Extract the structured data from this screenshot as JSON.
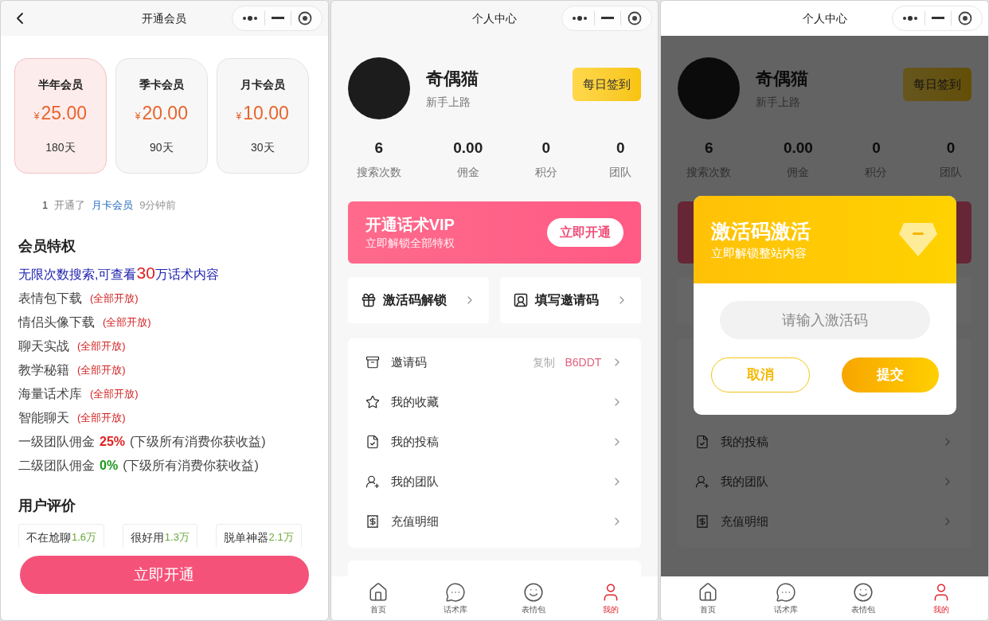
{
  "membership_page": {
    "title": "开通会员",
    "plans": [
      {
        "name": "半年会员",
        "currency": "¥",
        "price": "25.00",
        "duration": "180天",
        "selected": true
      },
      {
        "name": "季卡会员",
        "currency": "¥",
        "price": "20.00",
        "duration": "90天",
        "selected": false
      },
      {
        "name": "月卡会员",
        "currency": "¥",
        "price": "10.00",
        "duration": "30天",
        "selected": false
      }
    ],
    "ticker": {
      "index": "1",
      "action": "开通了",
      "plan": "月卡会员",
      "time": "9分钟前"
    },
    "privileges": {
      "heading": "会员特权",
      "headline": {
        "before": "无限次数搜索,可查看",
        "number": "30",
        "after": "万话术内容"
      },
      "features": [
        {
          "name": "表情包下载",
          "tag": "(全部开放)"
        },
        {
          "name": "情侣头像下载",
          "tag": "(全部开放)"
        },
        {
          "name": "聊天实战",
          "tag": "(全部开放)"
        },
        {
          "name": "教学秘籍",
          "tag": "(全部开放)"
        },
        {
          "name": "海量话术库",
          "tag": "(全部开放)"
        },
        {
          "name": "智能聊天",
          "tag": "(全部开放)"
        }
      ],
      "commissions": [
        {
          "label": "一级团队佣金",
          "rate": "25%",
          "note": "(下级所有消费你获收益)",
          "color": "#e02020"
        },
        {
          "label": "二级团队佣金",
          "rate": "0%",
          "note": "(下级所有消费你获收益)",
          "color": "#1a9a1a"
        }
      ]
    },
    "reviews": {
      "heading": "用户评价",
      "items": [
        {
          "text": "不在尬聊",
          "count": "1.6万"
        },
        {
          "text": "很好用",
          "count": "1.3万"
        },
        {
          "text": "脱单神器",
          "count": "2.1万"
        }
      ]
    },
    "cta": "立即开通"
  },
  "profile_page": {
    "title": "个人中心",
    "user": {
      "name": "奇偶猫",
      "level": "新手上路"
    },
    "checkin": "每日签到",
    "stats": [
      {
        "value": "6",
        "label": "搜索次数"
      },
      {
        "value": "0.00",
        "label": "佣金"
      },
      {
        "value": "0",
        "label": "积分"
      },
      {
        "value": "0",
        "label": "团队"
      }
    ],
    "vip_banner": {
      "title": "开通话术VIP",
      "subtitle": "立即解锁全部特权",
      "button": "立即开通"
    },
    "shortcuts": [
      {
        "label": "激活码解锁",
        "kind": "gift"
      },
      {
        "label": "填写邀请码",
        "kind": "contact"
      }
    ],
    "menu": [
      {
        "label": "邀请码",
        "kind": "invite",
        "action": "复制",
        "code": "B6DDT"
      },
      {
        "label": "我的收藏",
        "kind": "favorites"
      },
      {
        "label": "我的投稿",
        "kind": "submissions"
      },
      {
        "label": "我的团队",
        "kind": "team"
      },
      {
        "label": "充值明细",
        "kind": "recharge"
      }
    ],
    "tabbar": [
      {
        "label": "首页",
        "kind": "home",
        "selected": false
      },
      {
        "label": "话术库",
        "kind": "chat",
        "selected": false
      },
      {
        "label": "表情包",
        "kind": "smile",
        "selected": false
      },
      {
        "label": "我的",
        "kind": "user",
        "selected": true
      }
    ]
  },
  "dialog_page": {
    "title": "个人中心",
    "user": {
      "name": "奇偶猫",
      "level": "新手上路"
    },
    "checkin": "每日签到",
    "stats": [
      {
        "value": "6",
        "label": "搜索次数"
      },
      {
        "value": "0.00",
        "label": "佣金"
      },
      {
        "value": "0",
        "label": "积分"
      },
      {
        "value": "0",
        "label": "团队"
      }
    ],
    "menu": [
      {
        "label": "我的投稿",
        "kind": "submissions"
      },
      {
        "label": "我的团队",
        "kind": "team"
      },
      {
        "label": "充值明细",
        "kind": "recharge"
      }
    ],
    "tabbar": [
      {
        "label": "首页",
        "kind": "home",
        "selected": false
      },
      {
        "label": "话术库",
        "kind": "chat",
        "selected": false
      },
      {
        "label": "表情包",
        "kind": "smile",
        "selected": false
      },
      {
        "label": "我的",
        "kind": "user",
        "selected": true
      }
    ],
    "dialog": {
      "title": "激活码激活",
      "subtitle": "立即解锁整站内容",
      "placeholder": "请输入激活码",
      "cancel": "取消",
      "submit": "提交"
    }
  }
}
